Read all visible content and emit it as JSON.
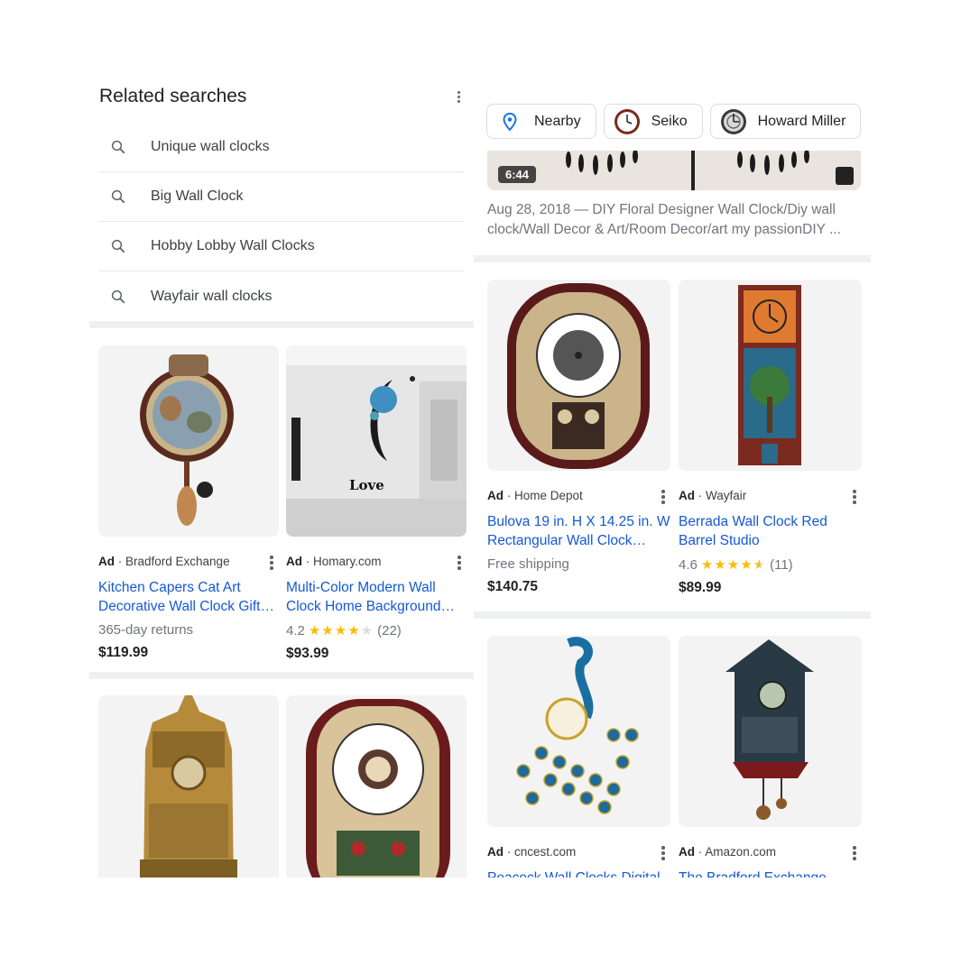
{
  "related": {
    "title": "Related searches",
    "items": [
      "Unique wall clocks",
      "Big Wall Clock",
      "Hobby Lobby Wall Clocks",
      "Wayfair wall clocks"
    ]
  },
  "left_products": [
    {
      "ad": "Ad",
      "seller": "Bradford Exchange",
      "title": "Kitchen Capers Cat Art Decorative Wall Clock Gift…",
      "sub": "365-day returns",
      "price": "$119.99"
    },
    {
      "ad": "Ad",
      "seller": "Homary.com",
      "title": "Multi-Color Modern Wall Clock Home Background…",
      "rating": "4.2",
      "reviews": "(22)",
      "stars": 4.2,
      "price": "$93.99",
      "img_text": "Love"
    }
  ],
  "chips": [
    {
      "label": "Nearby",
      "icon": "location-pin-icon"
    },
    {
      "label": "Seiko",
      "icon": "clock-thumbnail-icon"
    },
    {
      "label": "Howard Miller",
      "icon": "clock-thumbnail-icon"
    }
  ],
  "video": {
    "duration": "6:44",
    "description": "Aug 28, 2018 — DIY Floral Designer Wall Clock/Diy wall clock/Wall Decor & Art/Room Decor/art my passionDIY ..."
  },
  "right_products": [
    {
      "ad": "Ad",
      "seller": "Home Depot",
      "title": "Bulova 19 in. H X 14.25 in. W Rectangular Wall Clock…",
      "sub": "Free shipping",
      "price": "$140.75"
    },
    {
      "ad": "Ad",
      "seller": "Wayfair",
      "title": "Berrada Wall Clock Red Barrel Studio",
      "rating": "4.6",
      "reviews": "(11)",
      "stars": 4.6,
      "price": "$89.99"
    },
    {
      "ad": "Ad",
      "seller": "cncest.com",
      "title": "Peacock Wall Clocks Digital"
    },
    {
      "ad": "Ad",
      "seller": "Amazon.com",
      "title": "The Bradford Exchange"
    }
  ],
  "colors": {
    "link": "#1558d6",
    "star": "#fbbc04",
    "divider": "#eef0f2"
  }
}
